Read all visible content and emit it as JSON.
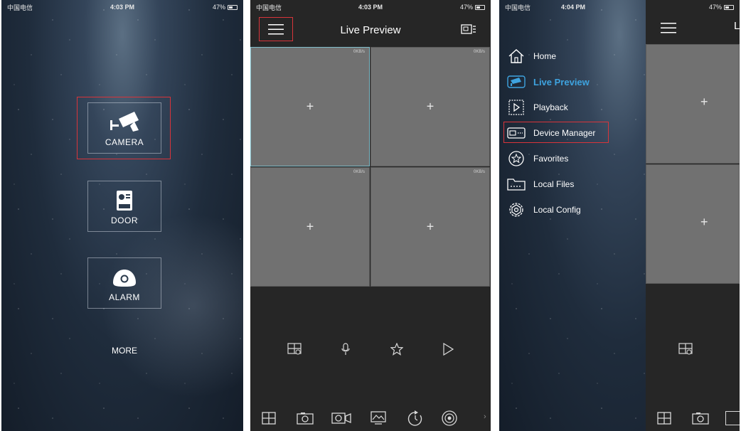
{
  "status": {
    "carrier": "中国电信",
    "time_home": "4:03 PM",
    "time_preview": "4:03 PM",
    "time_menu": "4:04 PM",
    "battery": "47%"
  },
  "home": {
    "tiles": [
      {
        "label": "CAMERA",
        "icon": "camera-icon"
      },
      {
        "label": "DOOR",
        "icon": "door-icon"
      },
      {
        "label": "ALARM",
        "icon": "alarm-icon"
      }
    ],
    "more": "MORE"
  },
  "preview": {
    "title": "Live Preview",
    "cells": [
      {
        "rate": "0KB/s",
        "icon": "add-icon"
      },
      {
        "rate": "0KB/s",
        "icon": "add-icon"
      },
      {
        "rate": "0KB/s",
        "icon": "add-icon"
      },
      {
        "rate": "0KB/s",
        "icon": "add-icon"
      }
    ],
    "controls": [
      "window-split-icon",
      "microphone-icon",
      "star-icon",
      "play-icon"
    ],
    "toolbar": [
      "split-screen-icon",
      "snapshot-icon",
      "record-icon",
      "image-adjust-icon",
      "playback-clock-icon",
      "fisheye-icon"
    ]
  },
  "side_menu": {
    "items": [
      {
        "label": "Home",
        "icon": "home-icon"
      },
      {
        "label": "Live Preview",
        "icon": "live-preview-icon",
        "active": true
      },
      {
        "label": "Playback",
        "icon": "playback-icon"
      },
      {
        "label": "Device Manager",
        "icon": "device-manager-icon"
      },
      {
        "label": "Favorites",
        "icon": "favorites-icon"
      },
      {
        "label": "Local Files",
        "icon": "local-files-icon"
      },
      {
        "label": "Local Config",
        "icon": "local-config-icon"
      }
    ]
  },
  "colors": {
    "highlight": "#d9343a",
    "active": "#3ea3df",
    "cell": "#717171",
    "dark": "#262626"
  }
}
